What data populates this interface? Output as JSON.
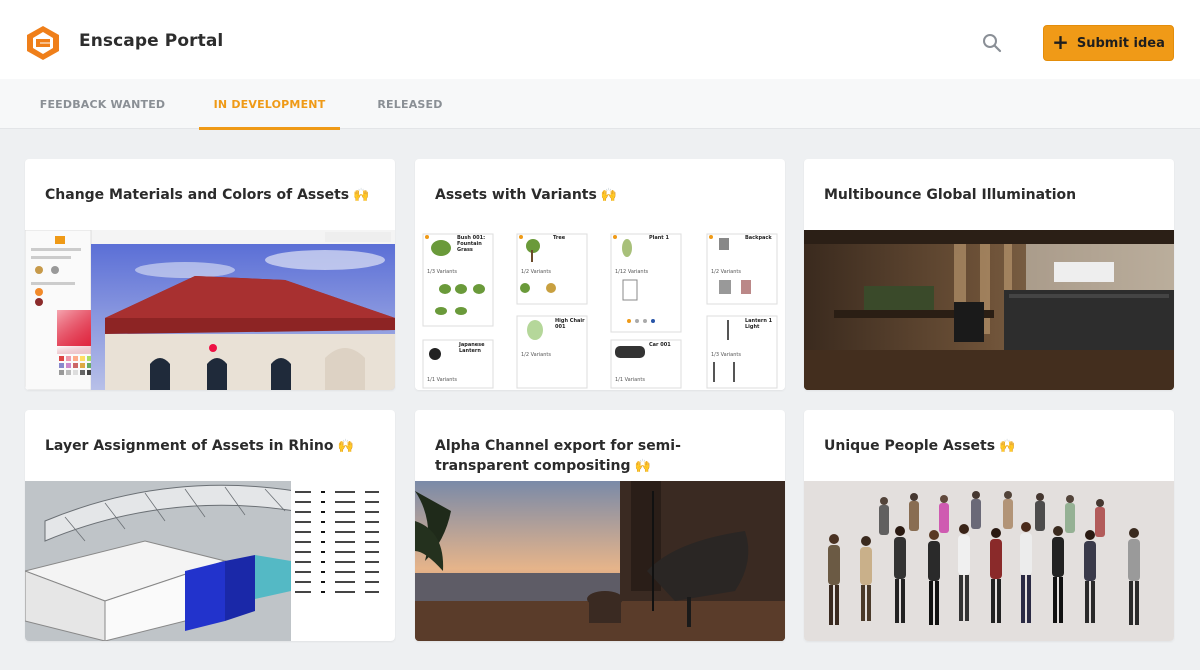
{
  "header": {
    "brand": "Enscape Portal",
    "brand_color": "#ef7f1a",
    "search_icon": "search-icon",
    "submit_label": "Submit idea",
    "submit_color": "#f09a17"
  },
  "tabs": [
    {
      "label": "FEEDBACK WANTED",
      "active": false
    },
    {
      "label": "IN DEVELOPMENT",
      "active": true
    },
    {
      "label": "RELEASED",
      "active": false
    }
  ],
  "cards": [
    {
      "title": "Change Materials and Colors of Assets",
      "emoji": "🙌"
    },
    {
      "title": "Assets with Variants",
      "emoji": "🙌"
    },
    {
      "title": "Multibounce Global Illumination",
      "emoji": ""
    },
    {
      "title": "Layer Assignment of Assets in Rhino",
      "emoji": "🙌"
    },
    {
      "title": "Alpha Channel export for semi-transparent compositing",
      "emoji": "🙌"
    },
    {
      "title": "Unique People Assets",
      "emoji": "🙌"
    }
  ],
  "variants_card": {
    "items": [
      {
        "name": "Bush 001: Fountain Grass",
        "variants": "1/3 Variants"
      },
      {
        "name": "Tree",
        "variants": "1/2 Variants"
      },
      {
        "name": "Plant 1",
        "variants": "1/12 Variants"
      },
      {
        "name": "Backpack",
        "variants": "1/2 Variants"
      },
      {
        "name": "High Chair 001",
        "variants": "1/2 Variants"
      },
      {
        "name": "Japanese Lantern",
        "variants": "1/1 Variants"
      },
      {
        "name": "Car 001",
        "variants": "1/1 Variants"
      },
      {
        "name": "Lantern 1 Light",
        "variants": "1/3 Variants"
      }
    ]
  }
}
